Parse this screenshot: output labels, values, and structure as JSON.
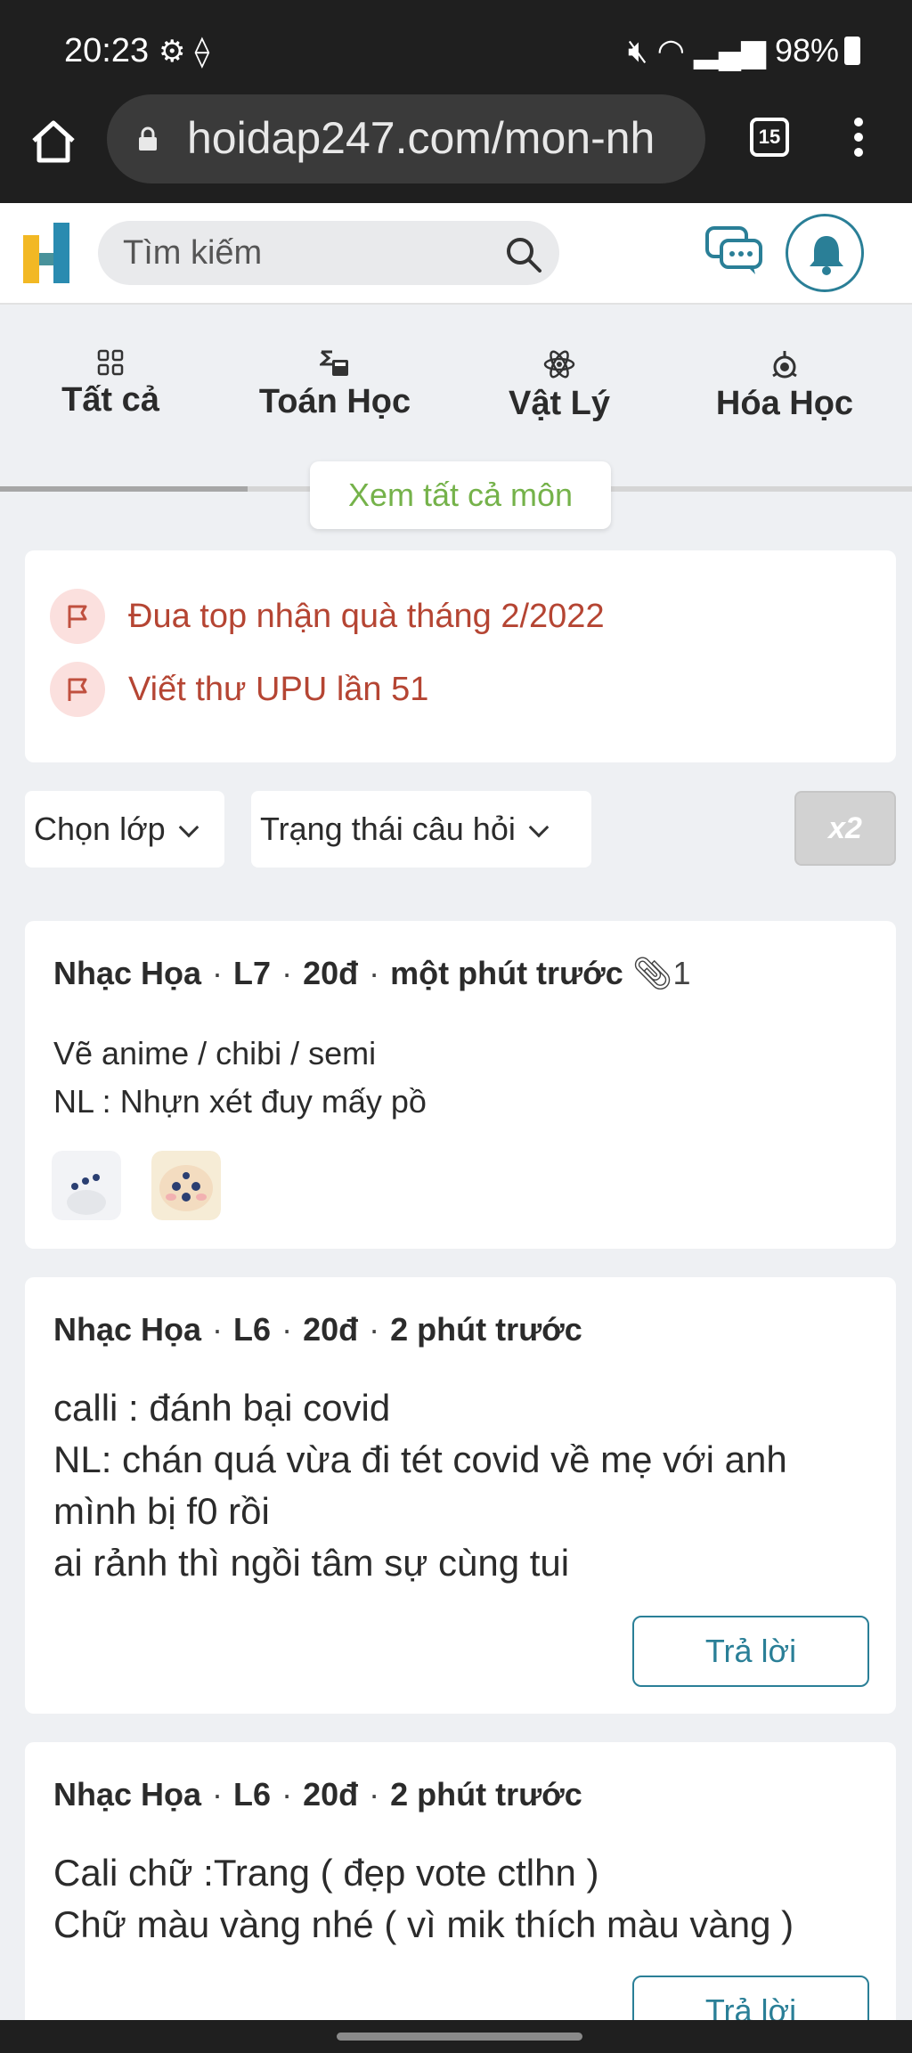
{
  "status_bar": {
    "time": "20:23",
    "left_icons": [
      "settings-icon",
      "location-icon"
    ],
    "battery": "98%",
    "right_icons": [
      "mute-icon",
      "wifi-icon",
      "signal-icon",
      "battery-icon"
    ]
  },
  "browser": {
    "url": "hoidap247.com/mon-nh",
    "tab_count": "15"
  },
  "header": {
    "search_placeholder": "Tìm kiếm",
    "accent_color": "#2a7f97"
  },
  "subjects": {
    "items": [
      {
        "label": "Tất cả",
        "icon": "grid-icon"
      },
      {
        "label": "Toán Học",
        "icon": "calculator-icon"
      },
      {
        "label": "Vật Lý",
        "icon": "atom-icon"
      },
      {
        "label": "Hóa Học",
        "icon": "flask-icon"
      }
    ],
    "view_all": "Xem tất cả môn"
  },
  "announcements": [
    {
      "text": "Đua top nhận quà tháng 2/2022",
      "icon": "flag-icon"
    },
    {
      "text": "Viết thư UPU lần 51",
      "icon": "flag-icon"
    }
  ],
  "filters": {
    "grade": "Chọn lớp",
    "status": "Trạng thái câu hỏi",
    "multiplier": "x2"
  },
  "posts": [
    {
      "subject": "Nhạc Họa",
      "grade": "L7",
      "points": "20đ",
      "time": "một phút trước",
      "attachments": "1",
      "lines": [
        "Vẽ anime / chibi / semi",
        "NL : Nhựn xét đuy mấy pồ"
      ]
    },
    {
      "subject": "Nhạc Họa",
      "grade": "L6",
      "points": "20đ",
      "time": "2 phút trước",
      "lines": [
        "calli : đánh bại covid",
        "NL: chán quá vừa đi tét covid về mẹ với anh",
        "mình bị f0 rồi",
        "ai rảnh thì ngồi tâm sự cùng tui"
      ],
      "reply_label": "Trả lời"
    },
    {
      "subject": "Nhạc Họa",
      "grade": "L6",
      "points": "20đ",
      "time": "2 phút trước",
      "lines": [
        "Cali chữ :Trang ( đẹp vote ctlhn )",
        "Chữ màu vàng nhé ( vì mik thích màu vàng )"
      ],
      "reply_label": "Trả lời"
    }
  ]
}
